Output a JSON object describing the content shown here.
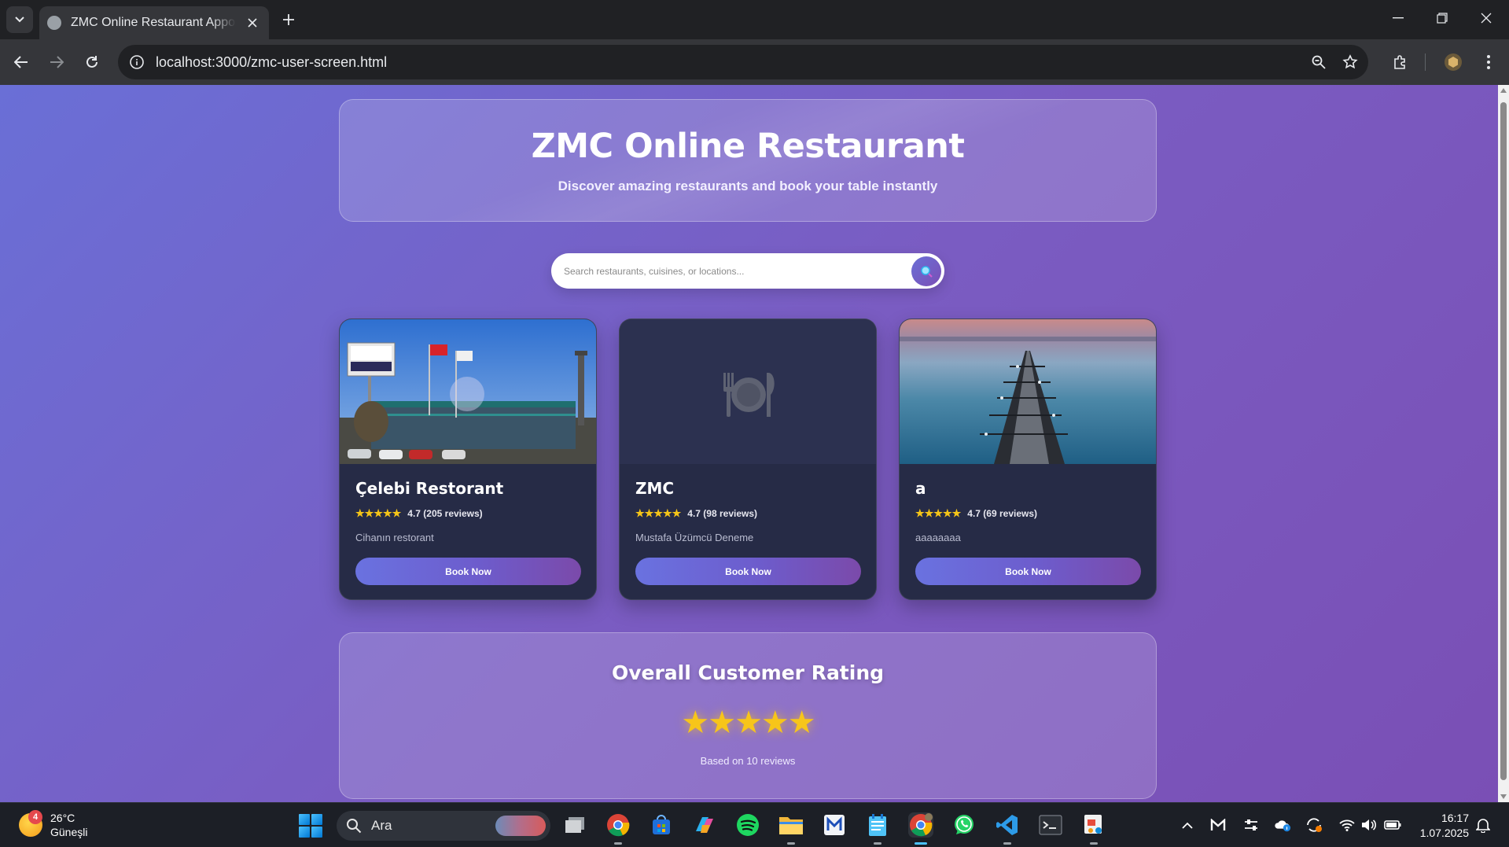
{
  "browser": {
    "tab_title": "ZMC Online Restaurant Appointment",
    "url": "localhost:3000/zmc-user-screen.html"
  },
  "hero": {
    "title": "ZMC Online Restaurant",
    "subtitle": "Discover amazing restaurants and book your table instantly"
  },
  "search": {
    "placeholder": "Search restaurants, cuisines, or locations..."
  },
  "restaurants": [
    {
      "name": "Çelebi Restorant",
      "stars": "★★★★★",
      "rating": "4.7 (205 reviews)",
      "description": "Cihanın restorant",
      "book_label": "Book Now"
    },
    {
      "name": "ZMC",
      "stars": "★★★★★",
      "rating": "4.7 (98 reviews)",
      "description": "Mustafa Üzümcü Deneme",
      "book_label": "Book Now"
    },
    {
      "name": "a",
      "stars": "★★★★★",
      "rating": "4.7 (69 reviews)",
      "description": "aaaaaaaa",
      "book_label": "Book Now"
    }
  ],
  "overall": {
    "title": "Overall Customer Rating",
    "stars": "★★★★★",
    "based_on": "Based on 10 reviews"
  },
  "taskbar": {
    "weather_badge": "4",
    "temperature": "26°C",
    "condition": "Güneşli",
    "search_label": "Ara",
    "time": "16:17",
    "date": "1.07.2025"
  },
  "colors": {
    "page_gradient_start": "#6a6fd6",
    "page_gradient_end": "#7a4fb5",
    "card_bg": "#262b46",
    "star": "#f5c518"
  }
}
